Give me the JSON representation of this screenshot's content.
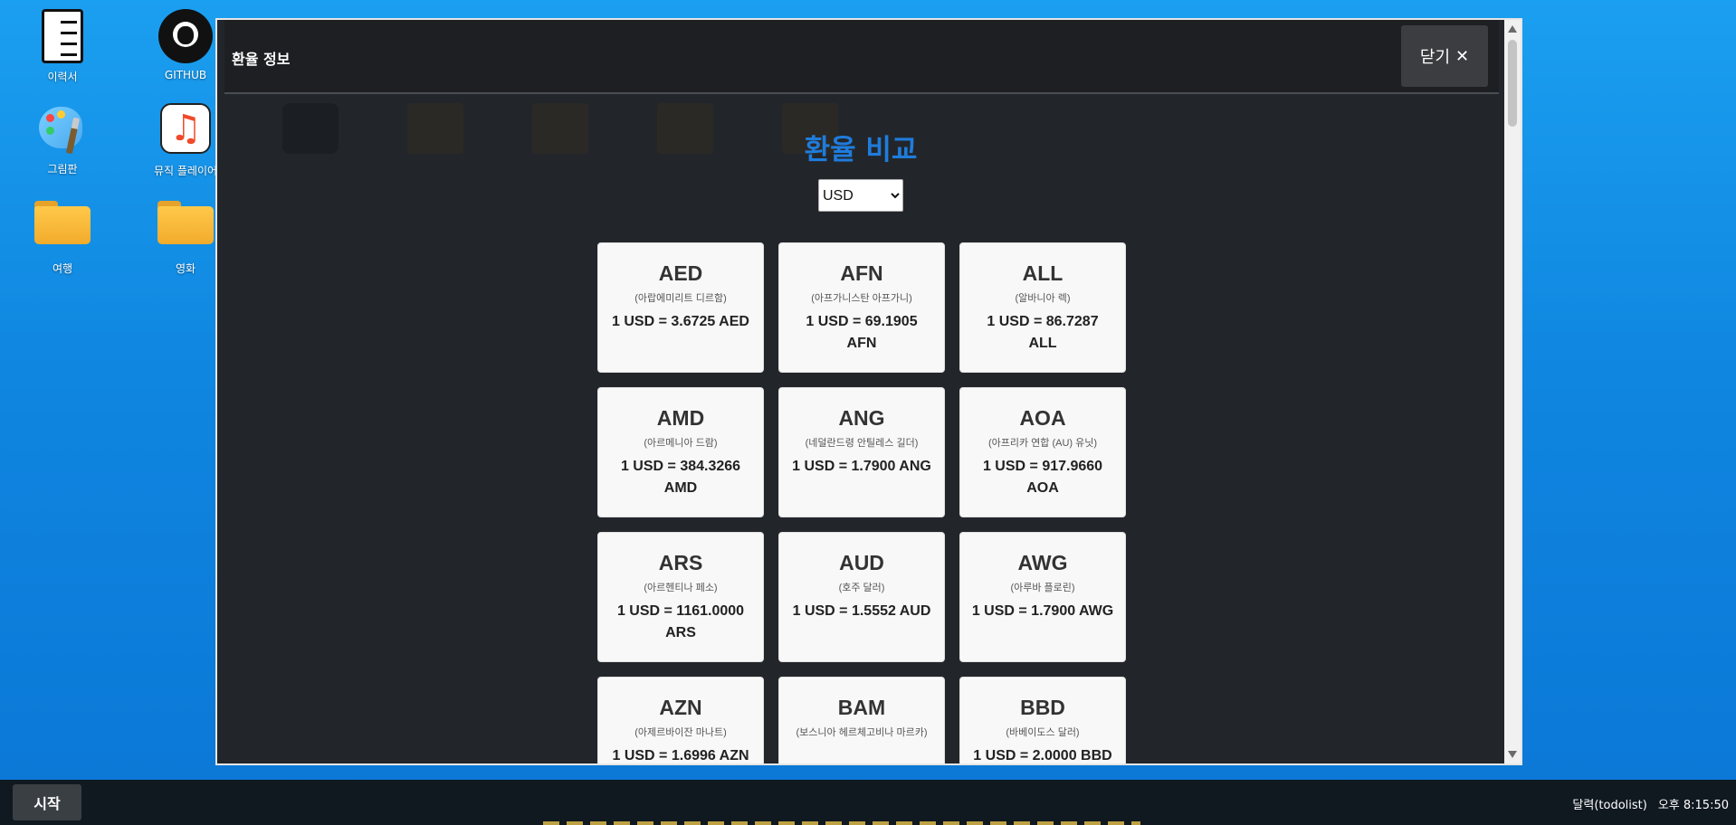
{
  "desktop": {
    "icons": [
      {
        "label": "이력서"
      },
      {
        "label": "GITHUB"
      },
      {
        "label": "그림판"
      },
      {
        "label": "뮤직 플레이어"
      },
      {
        "label": "여행"
      },
      {
        "label": "영화"
      }
    ]
  },
  "window": {
    "title": "환율 정보",
    "close_label": "닫기",
    "close_icon": "✕"
  },
  "main": {
    "heading": "환율 비교",
    "heading_color": "#1f7cdc",
    "base_currency": "USD",
    "cards": [
      {
        "code": "AED",
        "name": "(아랍에미리트 디르함)",
        "rate": "1 USD = 3.6725 AED"
      },
      {
        "code": "AFN",
        "name": "(아프가니스탄 아프가니)",
        "rate": "1 USD = 69.1905 AFN"
      },
      {
        "code": "ALL",
        "name": "(알바니아 렉)",
        "rate": "1 USD = 86.7287 ALL"
      },
      {
        "code": "AMD",
        "name": "(아르메니아 드람)",
        "rate": "1 USD = 384.3266 AMD"
      },
      {
        "code": "ANG",
        "name": "(네덜란드령 안틸레스 길더)",
        "rate": "1 USD = 1.7900 ANG"
      },
      {
        "code": "AOA",
        "name": "(아프리카 연합 (AU) 유닛)",
        "rate": "1 USD = 917.9660 AOA"
      },
      {
        "code": "ARS",
        "name": "(아르헨티나 페소)",
        "rate": "1 USD = 1161.0000 ARS"
      },
      {
        "code": "AUD",
        "name": "(호주 달러)",
        "rate": "1 USD = 1.5552 AUD"
      },
      {
        "code": "AWG",
        "name": "(아루바 플로린)",
        "rate": "1 USD = 1.7900 AWG"
      },
      {
        "code": "AZN",
        "name": "(아제르바이잔 마나트)",
        "rate": "1 USD = 1.6996 AZN"
      },
      {
        "code": "BAM",
        "name": "(보스니아 헤르체고비나 마르카)",
        "rate": ""
      },
      {
        "code": "BBD",
        "name": "(바베이도스 달러)",
        "rate": "1 USD = 2.0000 BBD"
      }
    ]
  },
  "taskbar": {
    "start_label": "시작",
    "tray_app": "달력(todolist)",
    "clock": "오후 8:15:50"
  }
}
